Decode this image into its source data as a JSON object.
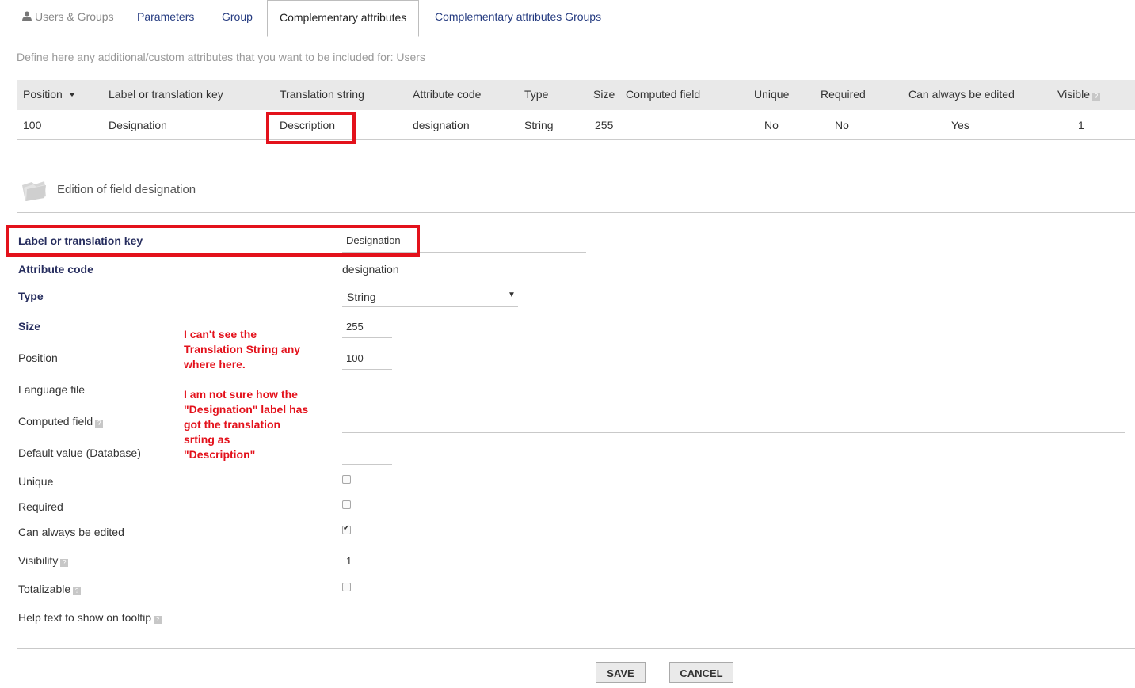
{
  "tabs": [
    {
      "label": "Users & Groups"
    },
    {
      "label": "Parameters"
    },
    {
      "label": "Group"
    },
    {
      "label": "Complementary attributes"
    },
    {
      "label": "Complementary attributes Groups"
    }
  ],
  "intro": "Define here any additional/custom attributes that you want to be included for: Users",
  "table": {
    "headers": [
      "Position",
      "Label or translation key",
      "Translation string",
      "Attribute code",
      "Type",
      "Size",
      "Computed field",
      "Unique",
      "Required",
      "Can always be edited",
      "Visible"
    ],
    "row": {
      "position": "100",
      "label": "Designation",
      "translation": "Description",
      "code": "designation",
      "type": "String",
      "size": "255",
      "computed": "",
      "unique": "No",
      "required": "No",
      "can_edit": "Yes",
      "visible": "1"
    }
  },
  "edition": {
    "title": "Edition of field designation",
    "fields": {
      "label_key": {
        "label": "Label or translation key",
        "value": "Designation"
      },
      "attribute_code": {
        "label": "Attribute code",
        "value": "designation"
      },
      "type": {
        "label": "Type",
        "value": "String"
      },
      "size": {
        "label": "Size",
        "value": "255"
      },
      "position": {
        "label": "Position",
        "value": "100"
      },
      "language_file": {
        "label": "Language file",
        "value": ""
      },
      "computed_field": {
        "label": "Computed field",
        "value": ""
      },
      "default_value": {
        "label": "Default value (Database)",
        "value": ""
      },
      "unique": {
        "label": "Unique",
        "checked": false
      },
      "required": {
        "label": "Required",
        "checked": false
      },
      "can_always_edit": {
        "label": "Can always be edited",
        "checked": true
      },
      "visibility": {
        "label": "Visibility",
        "value": "1"
      },
      "totalizable": {
        "label": "Totalizable",
        "checked": false
      },
      "help_text": {
        "label": "Help text to show on tooltip",
        "value": ""
      }
    }
  },
  "annotation": {
    "line1": "I can't see the",
    "line2": "Translation String any",
    "line3": "where here.",
    "line4": "I am not sure how the",
    "line5": "\"Designation\" label has",
    "line6": "got the translation",
    "line7": "srting as",
    "line8": "\"Description\""
  },
  "buttons": {
    "save": "SAVE",
    "cancel": "CANCEL"
  },
  "colors": {
    "accent": "#263c81",
    "highlight": "#e3111b",
    "header_bg": "#e9e9e9"
  }
}
